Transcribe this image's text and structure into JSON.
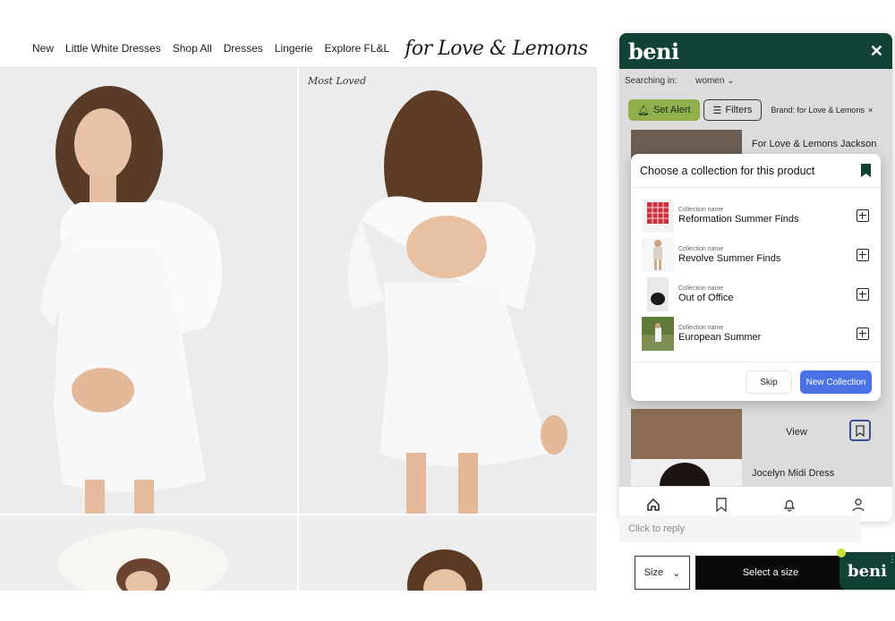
{
  "nav": {
    "links": [
      "New",
      "Little White Dresses",
      "Shop All",
      "Dresses",
      "Lingerie",
      "Explore FL&L"
    ],
    "logo": "for Love & Lemons"
  },
  "grid": {
    "badge": "Most Loved"
  },
  "beni": {
    "logo": "beni",
    "close": "✕",
    "searching_label": "Searching in:",
    "searching_value": "women",
    "set_alert": "Set Alert",
    "filters": "Filters",
    "brand_chip": "Brand: for Love & Lemons",
    "brand_remove": "×",
    "results": [
      {
        "title": "For Love & Lemons Jackson"
      },
      {
        "title": "Jocelyn Midi Dress"
      }
    ],
    "view_label": "View"
  },
  "modal": {
    "title": "Choose a collection for this product",
    "collection_label": "Collection name",
    "collections": [
      {
        "name": "Reformation Summer Finds"
      },
      {
        "name": "Revolve Summer Finds"
      },
      {
        "name": "Out of Office"
      },
      {
        "name": "European Summer"
      }
    ],
    "skip": "Skip",
    "new_collection": "New Collection"
  },
  "footer": {
    "reply_placeholder": "Click to reply",
    "size_label": "Size",
    "select_size": "Select a size",
    "fab_logo": "beni"
  },
  "colors": {
    "beni_green": "#124236",
    "alert_green": "#8fb04a",
    "accent_blue": "#4a72e6"
  }
}
